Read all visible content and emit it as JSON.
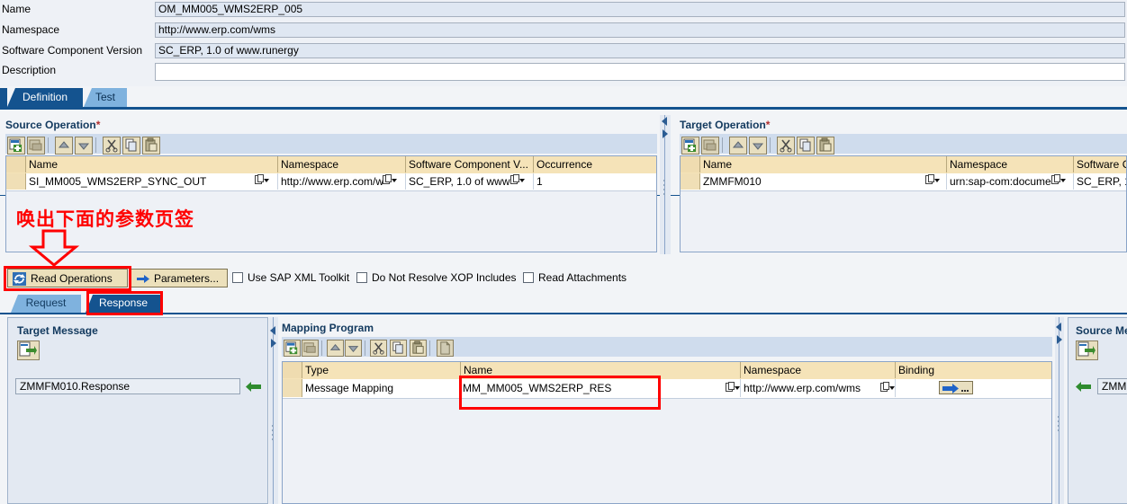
{
  "header": {
    "fields": [
      {
        "label": "Name",
        "value": "OM_MM005_WMS2ERP_005",
        "editable": false
      },
      {
        "label": "Namespace",
        "value": "http://www.erp.com/wms",
        "editable": false
      },
      {
        "label": "Software Component Version",
        "value": "SC_ERP, 1.0 of www.runergy",
        "editable": false
      },
      {
        "label": "Description",
        "value": "",
        "editable": true
      }
    ]
  },
  "main_tabs": [
    {
      "label": "Definition",
      "active": true
    },
    {
      "label": "Test",
      "active": false
    }
  ],
  "source_operation": {
    "title": "Source Operation",
    "required_marker": "*",
    "columns": [
      "",
      "Name",
      "Namespace",
      "Software Component V...",
      "Occurrence"
    ],
    "rows": [
      {
        "name": "SI_MM005_WMS2ERP_SYNC_OUT",
        "namespace": "http://www.erp.com/w",
        "scv": "SC_ERP, 1.0 of www",
        "occurrence": "1"
      }
    ],
    "toolbar_icons": [
      "insert-row-icon",
      "delete-row-icon",
      "move-up-icon",
      "move-down-icon",
      "cut-icon",
      "copy-icon",
      "paste-icon"
    ]
  },
  "target_operation": {
    "title": "Target Operation",
    "required_marker": "*",
    "columns": [
      "",
      "Name",
      "Namespace",
      "Software C"
    ],
    "rows": [
      {
        "name": "ZMMFM010",
        "namespace": "urn:sap-com:docume",
        "scv": "SC_ERP, 1"
      }
    ],
    "toolbar_icons": [
      "insert-row-icon",
      "delete-row-icon",
      "move-up-icon",
      "move-down-icon",
      "cut-icon",
      "copy-icon",
      "paste-icon"
    ]
  },
  "action_bar": {
    "read_operations_label": "Read Operations",
    "parameters_label": "Parameters...",
    "checkboxes": [
      {
        "label": "Use SAP XML Toolkit",
        "checked": false
      },
      {
        "label": "Do Not Resolve XOP Includes",
        "checked": false
      },
      {
        "label": "Read Attachments",
        "checked": false
      }
    ]
  },
  "sub_tabs": [
    {
      "label": "Request",
      "active": false
    },
    {
      "label": "Response",
      "active": true
    }
  ],
  "target_message": {
    "title": "Target Message",
    "value": "ZMMFM010.Response",
    "open_icon": "open-editor-icon",
    "link_icon": "green-left-arrow-icon"
  },
  "mapping_program": {
    "title": "Mapping Program",
    "columns": [
      "",
      "Type",
      "Name",
      "Namespace",
      "Binding"
    ],
    "rows": [
      {
        "type": "Message Mapping",
        "name": "MM_MM005_WMS2ERP_RES",
        "namespace": "http://www.erp.com/wms",
        "binding_icon": "binding-arrow-icon"
      }
    ],
    "toolbar_icons": [
      "insert-row-icon",
      "delete-row-icon",
      "move-up-icon",
      "move-down-icon",
      "cut-icon",
      "copy-icon",
      "paste-icon",
      "new-document-icon"
    ]
  },
  "source_message": {
    "title": "Source Me",
    "value": "ZMMF",
    "open_icon": "open-editor-icon",
    "link_icon": "green-left-arrow-icon"
  },
  "annotation": {
    "note_text": "唤出下面的参数页签",
    "arrow": "red-down-arrow",
    "color": "#ff0000",
    "highlight_targets": [
      "read-operations-button",
      "response-tab",
      "mapping-name-cell"
    ]
  }
}
